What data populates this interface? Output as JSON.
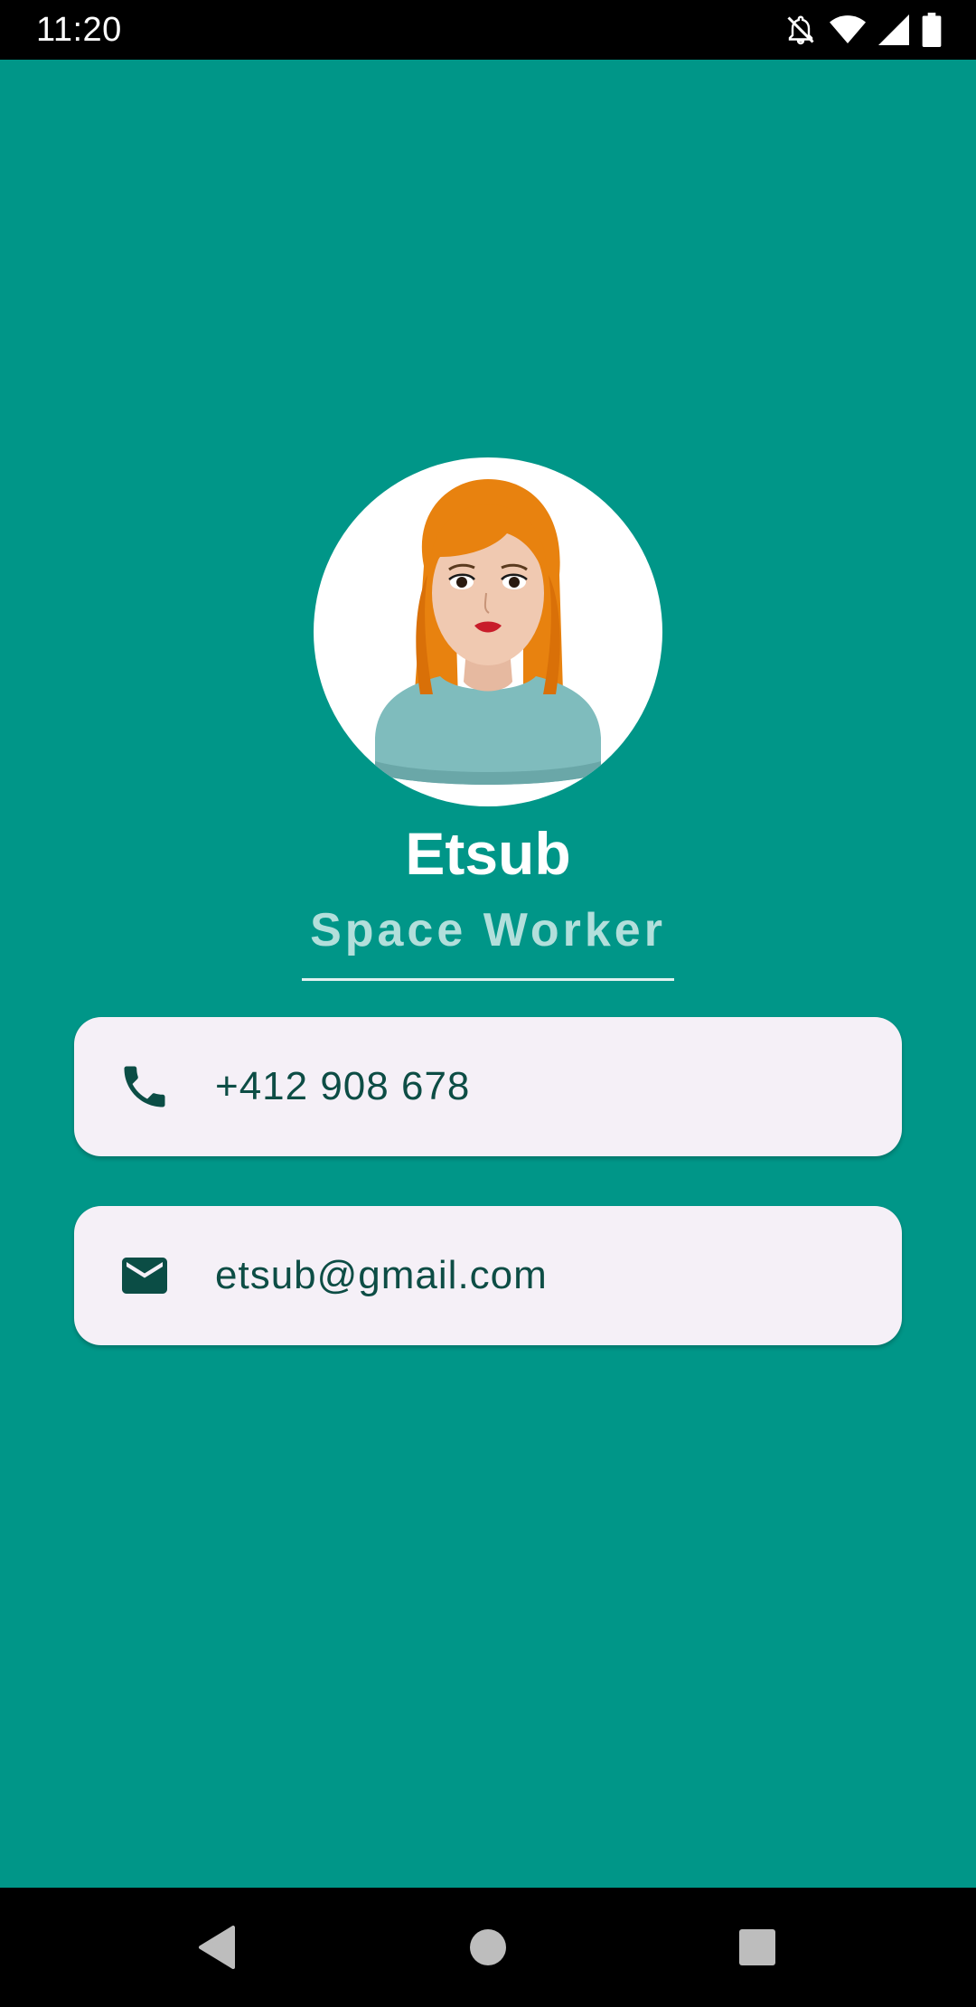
{
  "status_bar": {
    "time": "11:20",
    "icons": [
      "bell-off-icon",
      "wifi-icon",
      "signal-icon",
      "battery-icon"
    ]
  },
  "profile": {
    "name": "Etsub",
    "title": "Space Worker",
    "avatar_icon": "woman-avatar-icon"
  },
  "contacts": {
    "phone": {
      "icon": "phone-icon",
      "value": "+412 908 678"
    },
    "email": {
      "icon": "email-icon",
      "value": "etsub@gmail.com"
    }
  },
  "nav_bar": {
    "buttons": [
      "back-icon",
      "home-icon",
      "recents-icon"
    ]
  },
  "colors": {
    "background": "#009688",
    "title": "#b2dfdb",
    "card": "#f5f0f7",
    "card_text": "#0d4d45",
    "icon": "#0b4d45"
  }
}
